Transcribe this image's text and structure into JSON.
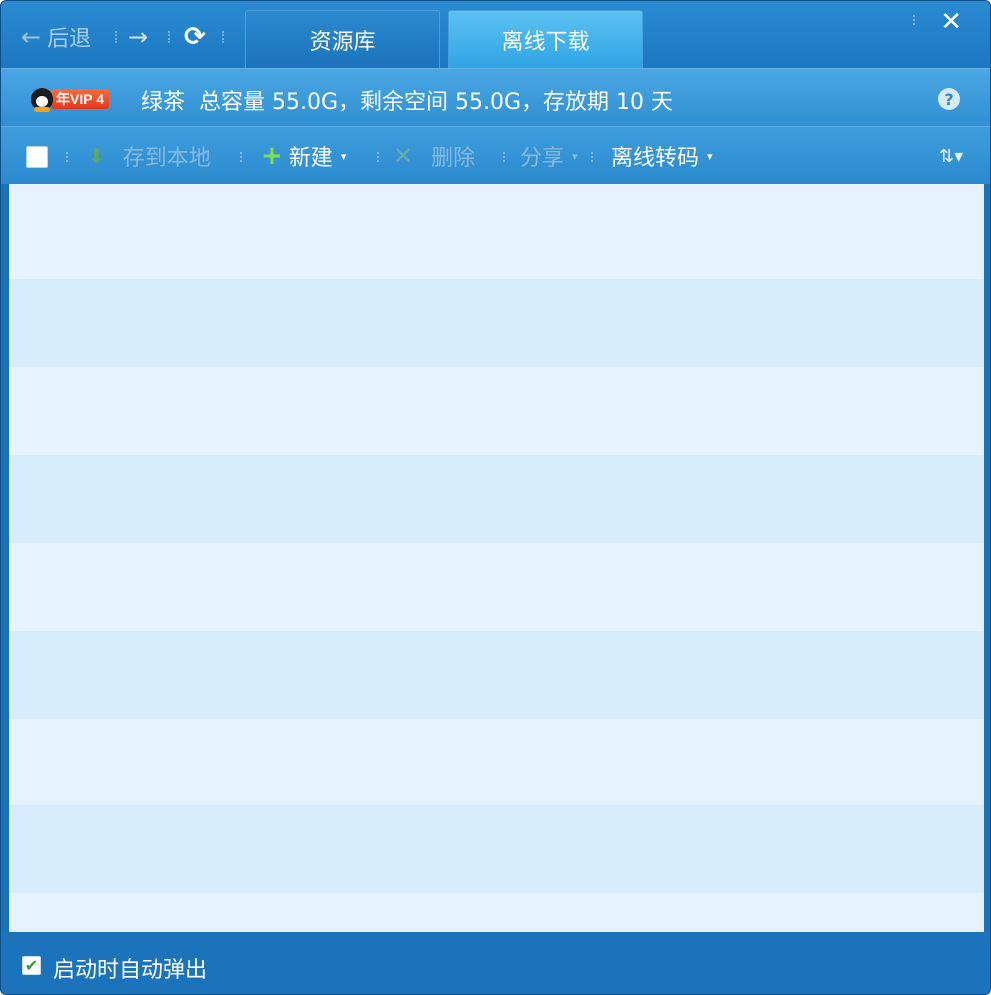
{
  "nav": {
    "back_arrow": "←",
    "back_label": "后退",
    "forward_arrow": "→",
    "refresh_glyph": "⟳"
  },
  "tabs": [
    {
      "label": "资源库",
      "active": false
    },
    {
      "label": "离线下载",
      "active": true
    }
  ],
  "window": {
    "close_glyph": "✕"
  },
  "info": {
    "vip_tag": "年VIP 4",
    "text": "绿茶  总容量 55.0G，剩余空间 55.0G，存放期 10 天",
    "help_glyph": "?"
  },
  "toolbar": {
    "save_local": "存到本地",
    "download_glyph": "⬇",
    "new_glyph": "+",
    "new_label": "新建",
    "delete_glyph": "✕",
    "delete_label": "删除",
    "share_label": "分享",
    "transcode_label": "离线转码",
    "caret": "▾",
    "sort_glyph": "⇅▾"
  },
  "status": {
    "auto_popup_label": "启动时自动弹出",
    "auto_popup_checked": true,
    "check_glyph": "✔"
  },
  "colors": {
    "accent": "#1a73b8",
    "list_bg": "#e6f3fd",
    "list_alt": "#d8edfc",
    "vip_red": "#e2381c",
    "new_green": "#7ee04b"
  }
}
